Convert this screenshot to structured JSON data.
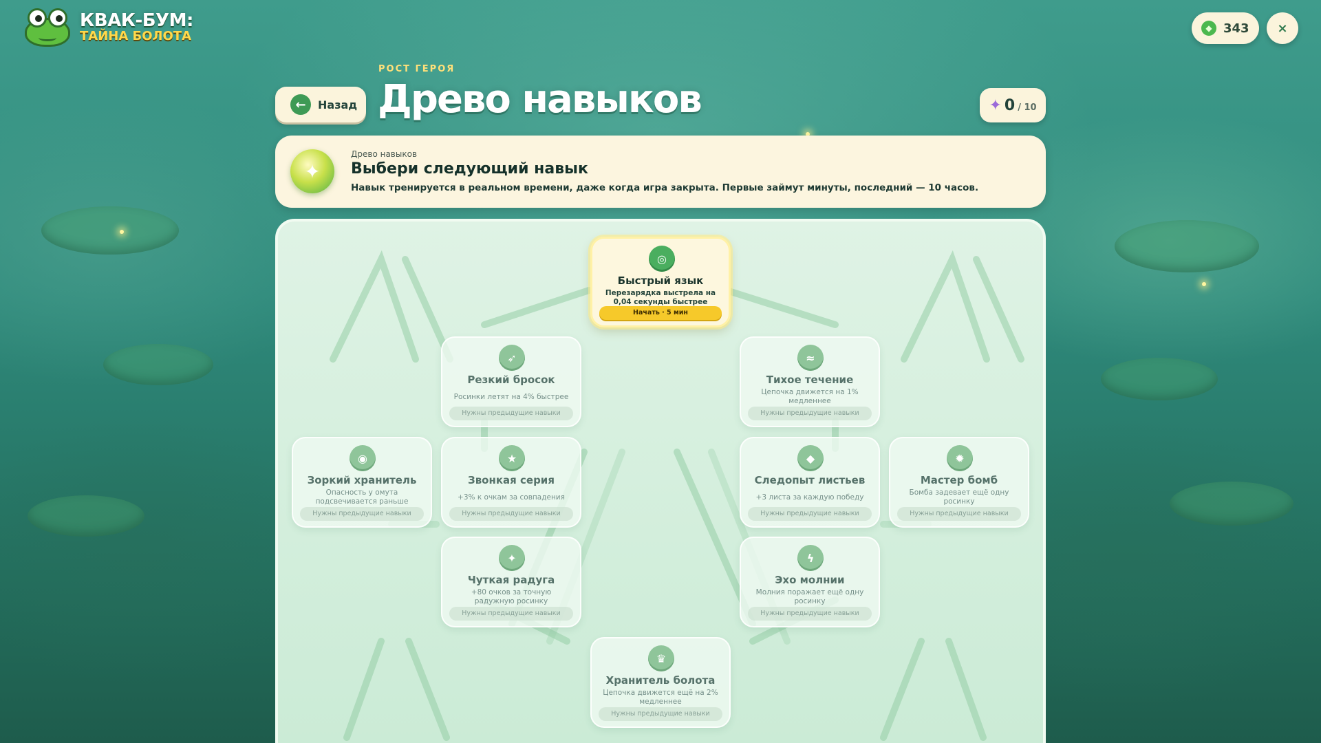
{
  "logo": {
    "title": "КВАК-БУМ:",
    "subtitle": "ТАЙНА БОЛОТА"
  },
  "top": {
    "coins": "343",
    "close": "×"
  },
  "header": {
    "kicker": "РОСТ ГЕРОЯ",
    "back_label": "Назад",
    "title": "Древо навыков",
    "points": "0",
    "points_max": "/ 10"
  },
  "banner": {
    "small": "Древо навыков",
    "title": "Выбери следующий навык",
    "desc": "Навык тренируется в реальном времени, даже когда игра закрыта. Первые займут минуты, последний — 10 часов."
  },
  "skills": [
    {
      "name": "Быстрый язык",
      "desc": "Перезарядка выстрела на 0,04 секунды быстрее",
      "status": "Начать · 5 мин",
      "icon": "◎",
      "icon_name": "target-icon"
    },
    {
      "name": "Резкий бросок",
      "desc": "Росинки летят на 4% быстрее",
      "status": "Нужны предыдущие навыки",
      "icon": "➶",
      "icon_name": "arrow-icon"
    },
    {
      "name": "Тихое течение",
      "desc": "Цепочка движется на 1% медленнее",
      "status": "Нужны предыдущие навыки",
      "icon": "≈",
      "icon_name": "wave-icon"
    },
    {
      "name": "Зоркий хранитель",
      "desc": "Опасность у омута подсвечивается раньше",
      "status": "Нужны предыдущие навыки",
      "icon": "◉",
      "icon_name": "eye-icon"
    },
    {
      "name": "Звонкая серия",
      "desc": "+3% к очкам за совпадения",
      "status": "Нужны предыдущие навыки",
      "icon": "★",
      "icon_name": "star-icon"
    },
    {
      "name": "Следопыт листьев",
      "desc": "+3 листа за каждую победу",
      "status": "Нужны предыдущие навыки",
      "icon": "◆",
      "icon_name": "leaf-icon"
    },
    {
      "name": "Мастер бомб",
      "desc": "Бомба задевает ещё одну росинку",
      "status": "Нужны предыдущие навыки",
      "icon": "✹",
      "icon_name": "bomb-icon"
    },
    {
      "name": "Чуткая радуга",
      "desc": "+80 очков за точную радужную росинку",
      "status": "Нужны предыдущие навыки",
      "icon": "✦",
      "icon_name": "sparkle-icon"
    },
    {
      "name": "Эхо молнии",
      "desc": "Молния поражает ещё одну росинку",
      "status": "Нужны предыдущие навыки",
      "icon": "ϟ",
      "icon_name": "lightning-icon"
    },
    {
      "name": "Хранитель болота",
      "desc": "Цепочка движется ещё на 2% медленнее",
      "status": "Нужны предыдущие навыки",
      "icon": "♛",
      "icon_name": "crown-icon"
    }
  ]
}
